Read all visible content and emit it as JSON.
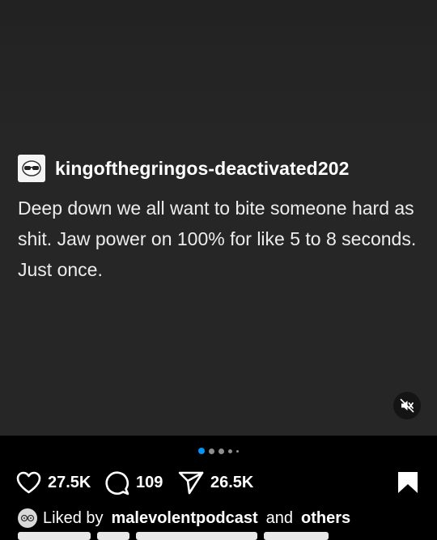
{
  "post": {
    "username": "kingofthegringos-deactivated202",
    "text": "Deep down we all want to bite someone hard as shit. Jaw power on 100% for like 5 to 8 seconds. Just once.",
    "carousel_active_index": 0,
    "carousel_count": 5
  },
  "actions": {
    "likes": "27.5K",
    "comments": "109",
    "shares": "26.5K"
  },
  "liked_by": {
    "prefix": "Liked by",
    "user": "malevolentpodcast",
    "joiner": "and",
    "others": "others"
  },
  "icons": {
    "mute": "speaker-muted-icon",
    "like": "heart-icon",
    "comment": "comment-bubble-icon",
    "share": "paper-plane-icon",
    "save": "bookmark-icon"
  },
  "colors": {
    "background": "#000000",
    "media": "#262626",
    "accent": "#0095f6"
  }
}
